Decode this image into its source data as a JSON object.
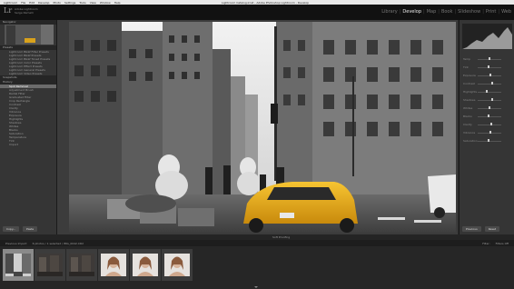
{
  "menubar": {
    "items": [
      "Lightroom",
      "File",
      "Edit",
      "Develop",
      "Photo",
      "Settings",
      "Tools",
      "View",
      "Window",
      "Help"
    ],
    "window_title": "Lightroom Catalog.lrcat - Adobe Photoshop Lightroom - Develop"
  },
  "app": {
    "logo": "Lr",
    "id_line1": "Adobe Lightroom",
    "id_line2": "Serge Ramelli"
  },
  "modules": [
    "Library",
    "Develop",
    "Map",
    "Book",
    "Slideshow",
    "Print",
    "Web"
  ],
  "active_module": "Develop",
  "left_panel": {
    "navigator_label": "Navigator",
    "presets_label": "Presets",
    "snapshots_label": "Snapshots",
    "history_label": "History",
    "preset_items": [
      "Lightroom B&W Filter Presets",
      "Lightroom B&W Presets",
      "Lightroom B&W Toned Presets",
      "Lightroom Color Presets",
      "Lightroom Effect Presets",
      "Lightroom General Presets",
      "Lightroom Video Presets"
    ],
    "history_items": [
      "Spot Removal",
      "Adjustment Brush",
      "Radial Filter",
      "Graduated Filter",
      "Crop Rectangle",
      "Contrast",
      "Clarity",
      "Vibrance",
      "Exposure",
      "Highlights",
      "Shadows",
      "Whites",
      "Blacks",
      "Saturation",
      "Temperature",
      "Tint",
      "Import"
    ],
    "copy_button": "Copy...",
    "paste_button": "Paste"
  },
  "right_panel": {
    "sliders": [
      "Temp",
      "Tint",
      "Exposure",
      "Contrast",
      "Highlights",
      "Shadows",
      "Whites",
      "Blacks",
      "Clarity",
      "Vibrance",
      "Saturation"
    ],
    "slider_levels": [
      0.5,
      0.45,
      0.55,
      0.6,
      0.4,
      0.62,
      0.5,
      0.48,
      0.58,
      0.52,
      0.45
    ],
    "previous_button": "Previous",
    "reset_button": "Reset"
  },
  "toolbar": {
    "soft_proofing": "Soft Proofing"
  },
  "filmstrip": {
    "source": "Previous Import",
    "count": "6 photos / 1 selected / IMG_0042.CR2",
    "filter_label": "Filter:",
    "filter_value": "Filters Off"
  },
  "thumbnails": [
    {
      "kind": "city-bw",
      "selected": true
    },
    {
      "kind": "city-dark",
      "selected": false
    },
    {
      "kind": "city-dark",
      "selected": false
    },
    {
      "kind": "portrait",
      "selected": false
    },
    {
      "kind": "portrait",
      "selected": false
    },
    {
      "kind": "portrait",
      "selected": false
    }
  ]
}
